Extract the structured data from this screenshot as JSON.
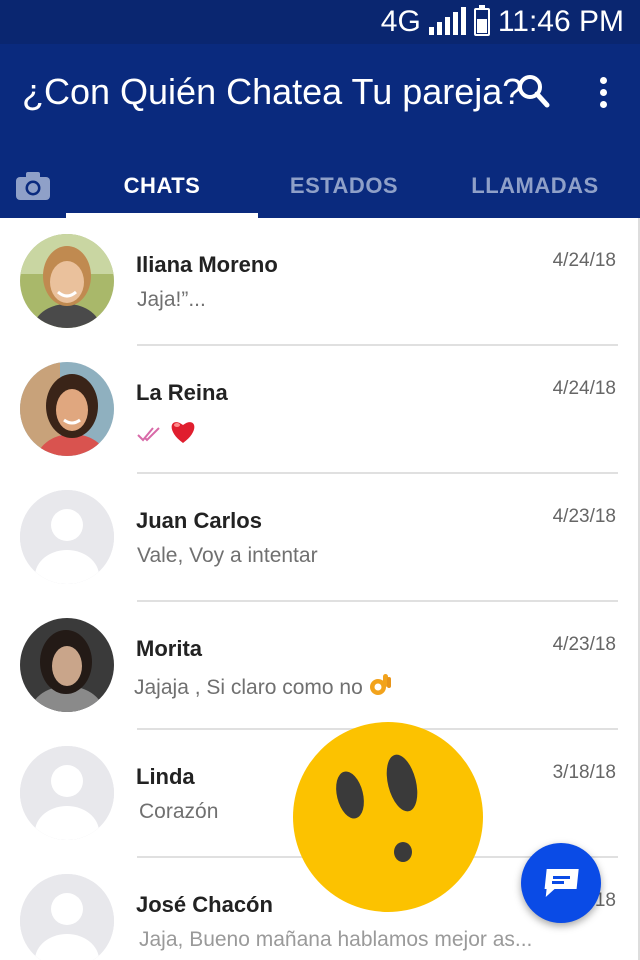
{
  "status_bar": {
    "network": "4G",
    "time": "11:46 PM"
  },
  "app_bar": {
    "title": "¿Con Quién Chatea Tu pareja?"
  },
  "tabs": [
    {
      "label": "CHATS",
      "active": true
    },
    {
      "label": "ESTADOS",
      "active": false
    },
    {
      "label": "LLAMADAS",
      "active": false
    }
  ],
  "chats": [
    {
      "name": "Iliana Moreno",
      "date": "4/24/18",
      "message": "Jaja!”...",
      "avatar": "photo-woman-blonde"
    },
    {
      "name": "La Reina",
      "date": "4/24/18",
      "message": "",
      "status_icons": [
        "double-check-icon",
        "heart-emoji"
      ],
      "avatar": "photo-woman-dark-hair"
    },
    {
      "name": "Juan Carlos",
      "date": "4/23/18",
      "message": "Vale, Voy a intentar",
      "avatar": "default-avatar"
    },
    {
      "name": "Morita",
      "date": "4/23/18",
      "message": "Jajaja , Si claro como no",
      "emoji": "ok-hand-emoji",
      "avatar": "photo-woman-hoodie"
    },
    {
      "name": "Linda",
      "date": "3/18/18",
      "message": "Corazón",
      "avatar": "default-avatar"
    },
    {
      "name": "José Chacón",
      "date": "18",
      "message": "Jaja, Bueno mañana hablamos mejor as...",
      "avatar": "default-avatar"
    }
  ],
  "colors": {
    "app_bar": "#0a2a7e",
    "status_bar": "#0a2670",
    "fab": "#0a4be6",
    "emoji": "#fcc200"
  }
}
